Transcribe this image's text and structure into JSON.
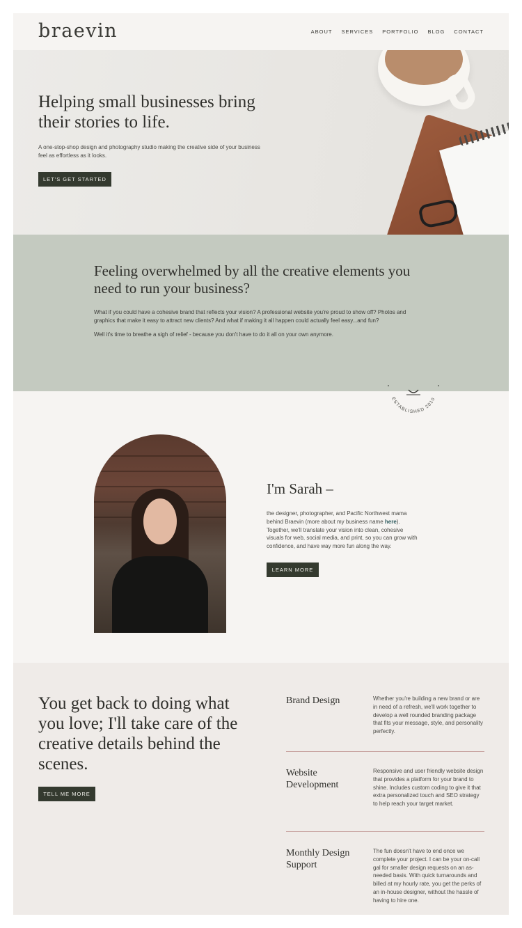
{
  "header": {
    "logo": "braevin",
    "nav": [
      "ABOUT",
      "SERVICES",
      "PORTFOLIO",
      "BLOG",
      "CONTACT"
    ]
  },
  "hero": {
    "title": "Helping small businesses bring their stories to life.",
    "text": "A one-stop-shop design and photography studio making the creative side of your business feel as effortless as it looks.",
    "button": "LET'S GET STARTED"
  },
  "overwhelmed": {
    "title": "Feeling overwhelmed by all the creative elements you need to run your business?",
    "p1": "What if you could have a cohesive brand that reflects your vision? A professional website you're proud to show off? Photos and graphics that make it easy to attract new clients? And what if making it all happen could actually feel easy...and fun?",
    "p2": "Well it's time to breathe a sigh of relief - because you don't have to do it all on your own anymore."
  },
  "about": {
    "badge": "ESTABLISHED 2010",
    "title": "I'm Sarah –",
    "text_before": "the designer, photographer, and Pacific Northwest mama behind Braevin (more about my business name ",
    "link": "here",
    "text_after": "). Together, we'll translate your vision into clean, cohesive visuals for web, social media, and print, so you can grow with confidence, and have way more fun along the way.",
    "button": "LEARN MORE"
  },
  "services": {
    "title": "You get back to doing what you love; I'll take care of the creative details behind the scenes.",
    "button": "TELL ME MORE",
    "items": [
      {
        "name": "Brand Design",
        "desc": "Whether you're building a new brand or are in need of a refresh, we'll work together to develop a well rounded branding package that fits your message, style, and personality perfectly."
      },
      {
        "name": "Website Development",
        "desc": "Responsive and user friendly website design that provides a platform for your brand to shine. Includes custom coding to give it that extra personalized touch and SEO strategy to help reach your target market."
      },
      {
        "name": "Monthly Design Support",
        "desc": "The fun doesn't have to end once we complete your project. I can be your on-call gal for smaller design requests on an as-needed basis. With quick turnarounds and billed at my hourly rate, you get the perks of an in-house designer, without the hassle of having to hire one."
      }
    ]
  },
  "colors": {
    "button_bg": "#343a2f",
    "sage_section": "#c4cac0",
    "divider": "#c9a5a2",
    "link": "#2d5a5e"
  }
}
